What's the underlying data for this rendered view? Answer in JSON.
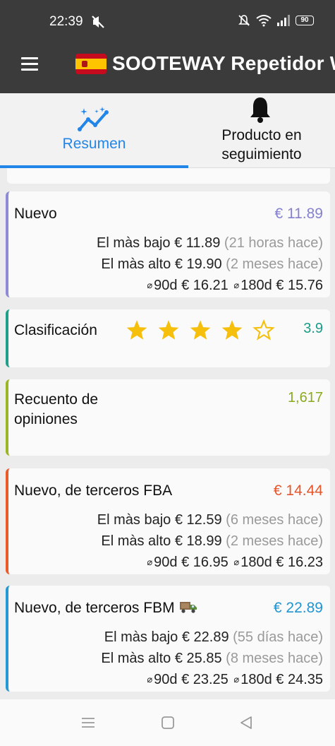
{
  "status_bar": {
    "time": "22:39",
    "battery": "90"
  },
  "app": {
    "title": "SOOTEWAY Repetidor W"
  },
  "tabs": [
    {
      "label": "Resumen",
      "icon": "trend-chart-icon",
      "active": true
    },
    {
      "label": "Producto en seguimiento",
      "icon": "bell-icon",
      "active": false
    }
  ],
  "cards": {
    "nuevo": {
      "title": "Nuevo",
      "price": "€ 11.89",
      "lowest_label": "El màs bajo",
      "lowest_value": "€ 11.89",
      "lowest_ago": "(21 horas hace)",
      "highest_label": "El màs alto",
      "highest_value": "€ 19.90",
      "highest_ago": "(2 meses hace)",
      "avg_symbol": "⌀",
      "avg90_label": "90d",
      "avg90_value": "€ 16.21",
      "avg180_label": "180d",
      "avg180_value": "€ 15.76",
      "accent": "#8f8ad6"
    },
    "rating": {
      "title": "Clasificación",
      "stars": 4,
      "max_stars": 5,
      "value": "3.9",
      "accent": "#20a08a"
    },
    "reviews": {
      "title": "Recuento de opiniones",
      "value": "1,617",
      "accent": "#9bb624"
    },
    "fba": {
      "title": "Nuevo, de terceros FBA",
      "price": "€ 14.44",
      "lowest_label": "El màs bajo",
      "lowest_value": "€ 12.59",
      "lowest_ago": "(6 meses hace)",
      "highest_label": "El màs alto",
      "highest_value": "€ 18.99",
      "highest_ago": "(2 meses hace)",
      "avg_symbol": "⌀",
      "avg90_label": "90d",
      "avg90_value": "€ 16.95",
      "avg180_label": "180d",
      "avg180_value": "€ 16.23",
      "accent": "#ea5b2a"
    },
    "fbm": {
      "title": "Nuevo, de terceros FBM",
      "price": "€ 22.89",
      "lowest_label": "El màs bajo",
      "lowest_value": "€ 22.89",
      "lowest_ago": "(55 días hace)",
      "highest_label": "El màs alto",
      "highest_value": "€ 25.85",
      "highest_ago": "(8 meses hace)",
      "avg_symbol": "⌀",
      "avg90_label": "90d",
      "avg90_value": "€ 23.25",
      "avg180_label": "180d",
      "avg180_value": "€ 24.35",
      "accent": "#2499d3"
    }
  },
  "colors": {
    "primary": "#2286e8",
    "app_bar": "#3b3b3b",
    "star": "#f5bf0c"
  }
}
